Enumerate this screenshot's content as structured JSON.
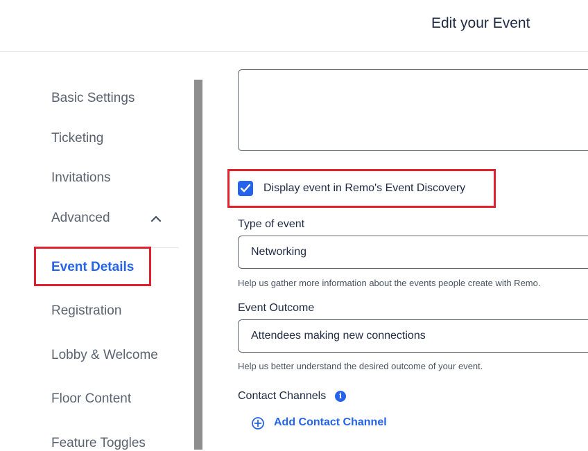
{
  "header": {
    "title": "Edit your Event"
  },
  "sidebar": {
    "items": [
      {
        "label": "Basic Settings"
      },
      {
        "label": "Ticketing"
      },
      {
        "label": "Invitations"
      },
      {
        "label": "Advanced"
      },
      {
        "label": "Event Details"
      },
      {
        "label": "Registration"
      },
      {
        "label": "Lobby & Welcome"
      },
      {
        "label": "Floor Content"
      },
      {
        "label": "Feature Toggles"
      }
    ],
    "active_item": "Event Details"
  },
  "form": {
    "discovery_checkbox": {
      "label": "Display event in Remo's Event Discovery",
      "checked": true
    },
    "type_of_event": {
      "label": "Type of event",
      "value": "Networking",
      "help": "Help us gather more information about the events people create with Remo."
    },
    "event_outcome": {
      "label": "Event Outcome",
      "value": "Attendees making new connections",
      "help": "Help us better understand the desired outcome of your event."
    },
    "contact_channels": {
      "label": "Contact Channels",
      "info_icon": "i",
      "add_label": "Add Contact Channel"
    }
  },
  "colors": {
    "accent": "#2563eb",
    "highlight": "#e0202e",
    "text": "#1f2a44",
    "muted": "#5b6370"
  },
  "icons": {
    "chevron": "chevron-up-icon",
    "check": "check-icon",
    "info": "info-icon",
    "add": "plus-circle-icon"
  }
}
